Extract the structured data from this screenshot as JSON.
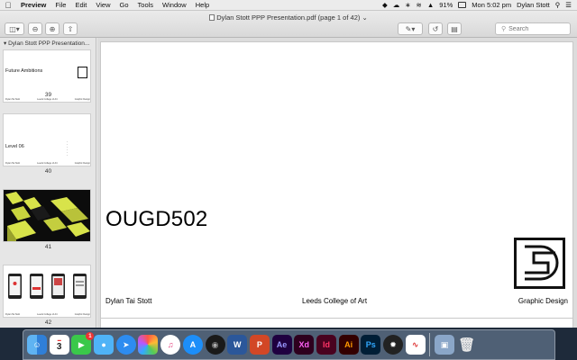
{
  "menubar": {
    "app_name": "Preview",
    "items": [
      "File",
      "Edit",
      "View",
      "Go",
      "Tools",
      "Window",
      "Help"
    ],
    "battery": "91%",
    "clock": "Mon 5:02 pm",
    "user": "Dylan Stott"
  },
  "window": {
    "title": "Dylan Stott PPP Presentation.pdf (page 1 of 42)",
    "search_placeholder": "Search"
  },
  "sidebar": {
    "header": "Dylan Stott PPP Presentation...",
    "thumbnails": [
      {
        "num": "39",
        "title": "Future Ambitions"
      },
      {
        "num": "40",
        "title": "Level 06"
      },
      {
        "num": "41"
      },
      {
        "num": "42"
      }
    ],
    "thumb_footer": [
      "Dylan Tai Stott",
      "Leeds College of Art",
      "Graphic Design"
    ]
  },
  "page": {
    "title": "OUGD502",
    "footer_left": "Dylan Tai Stott",
    "footer_center": "Leeds College of Art",
    "footer_right": "Graphic Design"
  },
  "dock": {
    "calendar_day": "3",
    "facetime_badge": "1",
    "apps": [
      "finder",
      "calendar",
      "facetime",
      "messages",
      "safari",
      "photos",
      "itunes",
      "app-store",
      "cinema4d",
      "word",
      "powerpoint",
      "after-effects",
      "xd",
      "indesign",
      "illustrator",
      "photoshop",
      "davinci",
      "wps",
      "preview",
      "trash"
    ]
  },
  "colors": {
    "accent_yellow": "#d8e34a",
    "photoshop_blue": "#31a8ff",
    "illustrator_orange": "#ff9a00",
    "indesign_pink": "#ff3366",
    "xd_pink": "#ff61f6",
    "ae_violet": "#9999ff"
  }
}
